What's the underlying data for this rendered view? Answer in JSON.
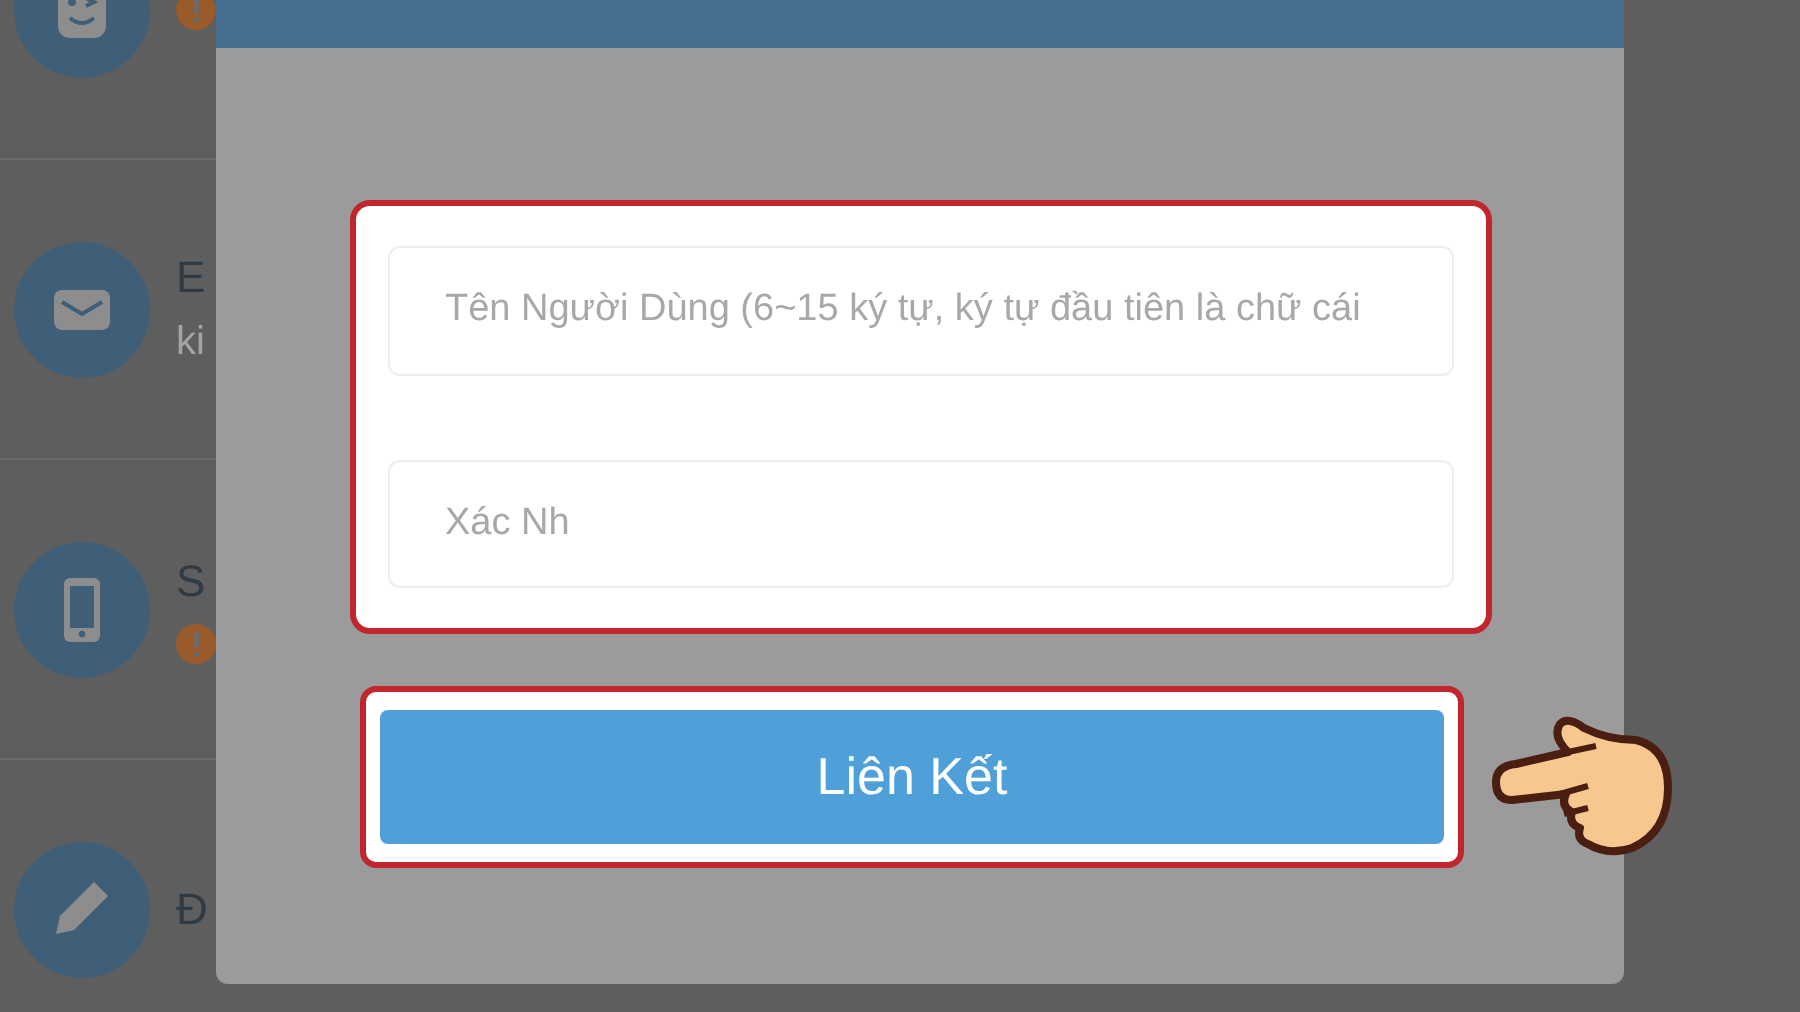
{
  "background_list": [
    {
      "warning": true
    },
    {
      "title": "E",
      "warning": false,
      "subtitle": "ki"
    },
    {
      "title": "S",
      "warning": true
    },
    {
      "title": "Đ",
      "warning": false
    }
  ],
  "dialog": {
    "fields": [
      {
        "placeholder": "Tên Người Dùng (6~15 ký tự, ký tự đầu tiên là chữ cái"
      },
      {
        "placeholder": "Xác Nh"
      }
    ],
    "button": "Liên Kết"
  }
}
